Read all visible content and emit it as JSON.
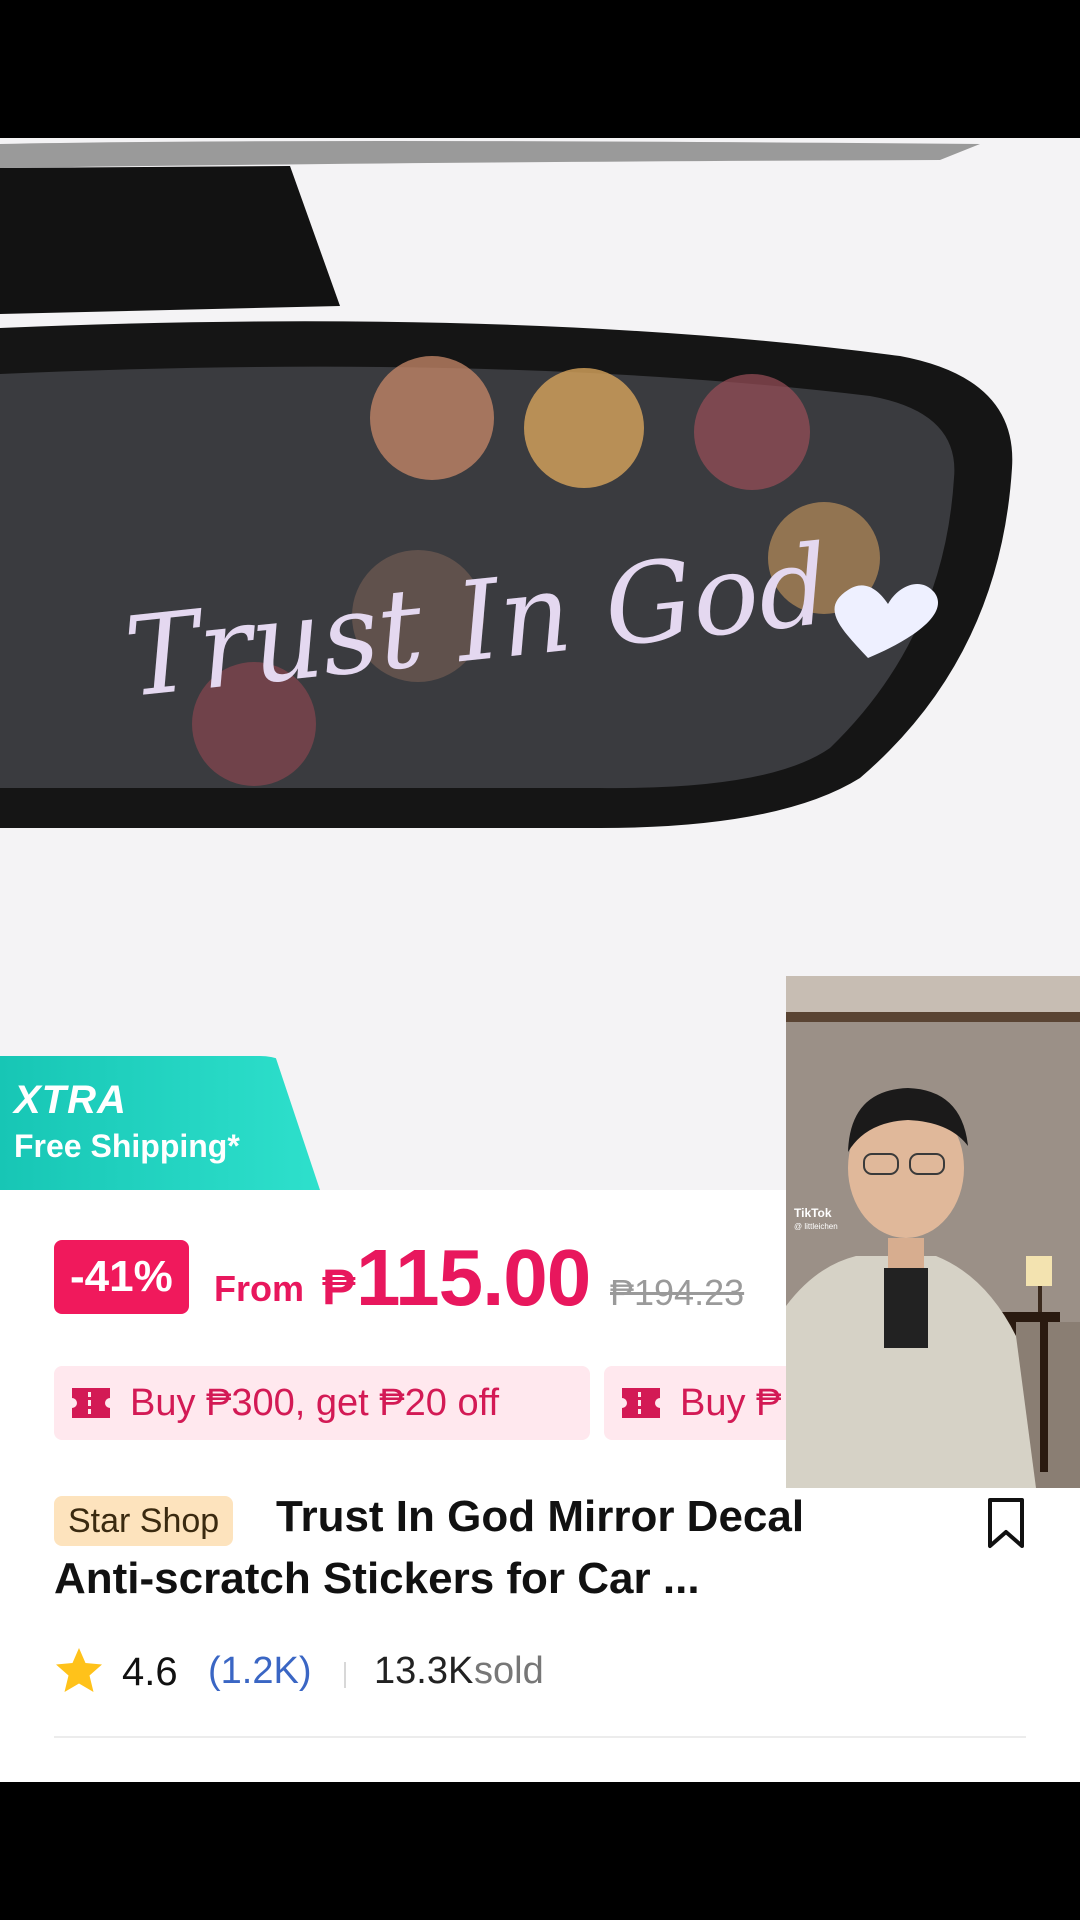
{
  "product": {
    "image_text": "Trust In God",
    "xtra_title": "XTRA",
    "xtra_subtitle": "Free Shipping*",
    "discount": "-41%",
    "price_from": "From",
    "currency": "₱",
    "price": "115.00",
    "original_price": "₱194.23",
    "vouchers": [
      "Buy ₱300, get ₱20 off",
      "Buy ₱"
    ],
    "shop_badge": "Star Shop",
    "title_line1": "Trust In God Mirror Decal",
    "title_line2": "Anti-scratch Stickers for Car ...",
    "rating": "4.6",
    "reviews": "(1.2K)",
    "sold_count": "13.3K",
    "sold_label": "sold"
  },
  "video": {
    "brand": "TikTok",
    "username": "@ littleichen"
  },
  "colors": {
    "accent": "#e8175d",
    "xtra": "#1fd1c0",
    "shop_badge": "#fde3bd",
    "link": "#3a66c4"
  },
  "icons": [
    "voucher-icon",
    "bookmark-icon",
    "star-icon",
    "heart-icon"
  ]
}
